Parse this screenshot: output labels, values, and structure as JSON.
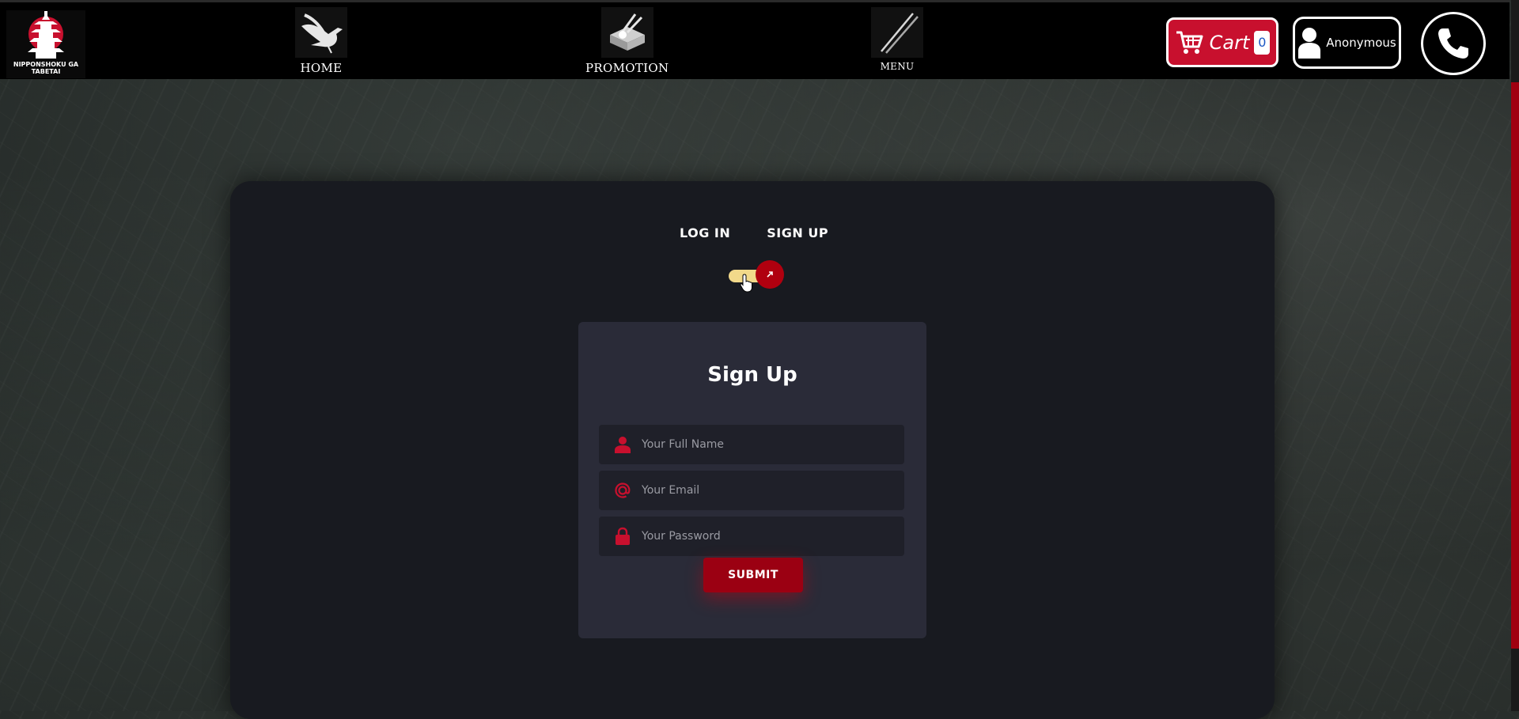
{
  "brand": {
    "name_line1": "NIPPONSHOKU GA",
    "name_line2": "TABETAI"
  },
  "nav": [
    {
      "label": "HOME",
      "icon": "crane-icon"
    },
    {
      "label": "PROMOTION",
      "icon": "bento-icon"
    },
    {
      "label": "MENU",
      "icon": "chopsticks-icon"
    }
  ],
  "cart": {
    "label": "Cart",
    "count": "0"
  },
  "user": {
    "label": "Anonymous"
  },
  "auth": {
    "login_label": "LOG IN",
    "signup_label": "SIGN UP",
    "toggle_state": "signup",
    "form_title": "Sign Up",
    "fields": [
      {
        "placeholder": "Your Full Name",
        "icon": "user-icon"
      },
      {
        "placeholder": "Your Email",
        "icon": "at-icon"
      },
      {
        "placeholder": "Your Password",
        "icon": "lock-icon"
      }
    ],
    "submit_label": "SUBMIT"
  },
  "colors": {
    "accent": "#c8102e",
    "toggle_track": "#f2d98a",
    "panel": "#181a20",
    "card": "#2a2b38"
  }
}
